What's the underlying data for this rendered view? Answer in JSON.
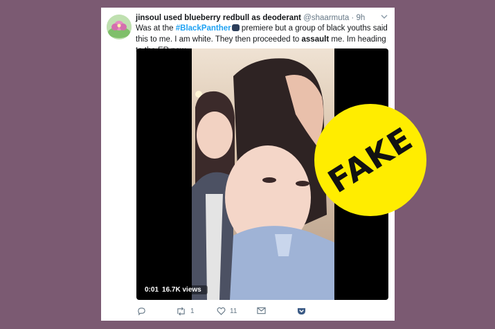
{
  "tweet": {
    "display_name": "jinsoul used blueberry redbull as deoderant",
    "handle": "@shaarmuta",
    "time": "· 9h",
    "text_part1": "Was at the ",
    "hashtag": "#BlackPanther",
    "text_part2": " premiere but a group of black youths said this to me. I am white. They then proceeded to ",
    "bold_word": "assault",
    "text_part3": " me. Im heading to the ER now."
  },
  "video": {
    "time": "0:01",
    "views": "16.7K views"
  },
  "actions": {
    "retweets": "1",
    "likes": "11"
  },
  "stamp": {
    "label": "FAKE",
    "color": "#ffed00"
  }
}
